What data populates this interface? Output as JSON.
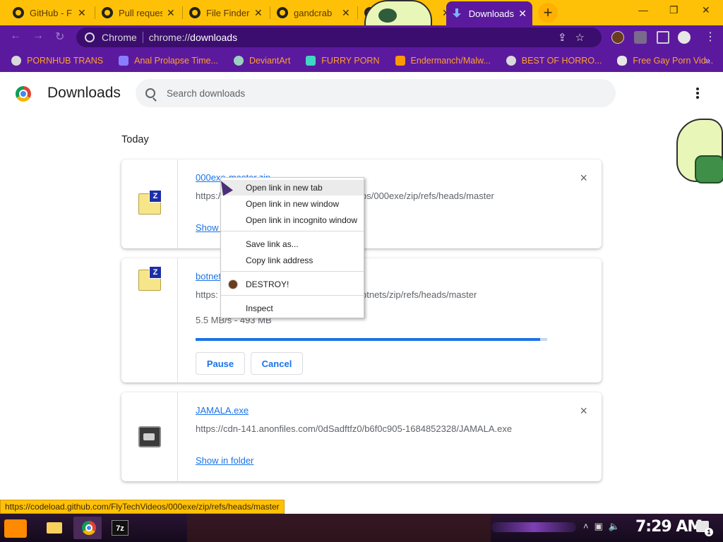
{
  "browser": {
    "tabs": [
      {
        "label": "GitHub - F",
        "active": false
      },
      {
        "label": "Pull reques",
        "active": false
      },
      {
        "label": "File Finder",
        "active": false
      },
      {
        "label": "gandcrab",
        "active": false
      },
      {
        "label": "",
        "active": false
      },
      {
        "label": "Downloads",
        "active": true
      }
    ],
    "new_tab": "+",
    "window_controls": {
      "minimize": "—",
      "maximize": "❐",
      "close": "✕"
    },
    "omnibox": {
      "site": "Chrome",
      "scheme": "chrome://",
      "host": "downloads"
    },
    "bookmarks": [
      {
        "label": "PORNHUB TRANS",
        "icon": "globe-icon"
      },
      {
        "label": "Anal Prolapse Time...",
        "icon": "bookmark-icon"
      },
      {
        "label": "DeviantArt",
        "icon": "deviantart-icon"
      },
      {
        "label": "FURRY PORN",
        "icon": "letter-a-icon"
      },
      {
        "label": "Endermanch/Malw...",
        "icon": "ph-icon"
      },
      {
        "label": "BEST OF HORRO...",
        "icon": "globe-icon"
      },
      {
        "label": "Free Gay Porn Vid...",
        "icon": "skull-icon"
      }
    ],
    "bookmarks_more": "»"
  },
  "page": {
    "title": "Downloads",
    "search_placeholder": "Search downloads",
    "section_date": "Today"
  },
  "downloads": [
    {
      "name": "000exe-master.zip",
      "url_prefix": "https://",
      "url_suffix": "os/000exe/zip/refs/heads/master",
      "link": "Show in folder",
      "close": "×"
    },
    {
      "name": "botnets-master.zip",
      "url_prefix": "https:",
      "url_suffix": "otnets/zip/refs/heads/master",
      "status": "5.5 MB/s - 493 MB",
      "progress": 0.98,
      "pause_label": "Pause",
      "cancel_label": "Cancel"
    },
    {
      "name": "JAMALA.exe",
      "url": "https://cdn-141.anonfiles.com/0dSadftfz0/b6f0c905-1684852328/JAMALA.exe",
      "link": "Show in folder",
      "close": "×"
    }
  ],
  "context_menu": {
    "items": [
      {
        "label": "Open link in new tab",
        "highlighted": true
      },
      {
        "label": "Open link in new window"
      },
      {
        "label": "Open link in incognito window"
      },
      {
        "label": "Save link as..."
      },
      {
        "label": "Copy link address"
      },
      {
        "label": "DESTROY!",
        "icon": "avatar-icon"
      },
      {
        "label": "Inspect"
      }
    ]
  },
  "status_url": "https://codeload.github.com/FlyTechVideos/000exe/zip/refs/heads/master",
  "taskbar": {
    "clock": "7:29 AM",
    "apps": [
      "start-icon",
      "folder-icon",
      "chrome-icon",
      "7zip-icon"
    ],
    "sevenzip_label": "7z",
    "notification_count": "1"
  },
  "colors": {
    "tab_strip": "#ffc107",
    "toolbar": "#5b1a9e",
    "bookmark_text": "#ff9f2e",
    "link": "#1a73e8"
  }
}
